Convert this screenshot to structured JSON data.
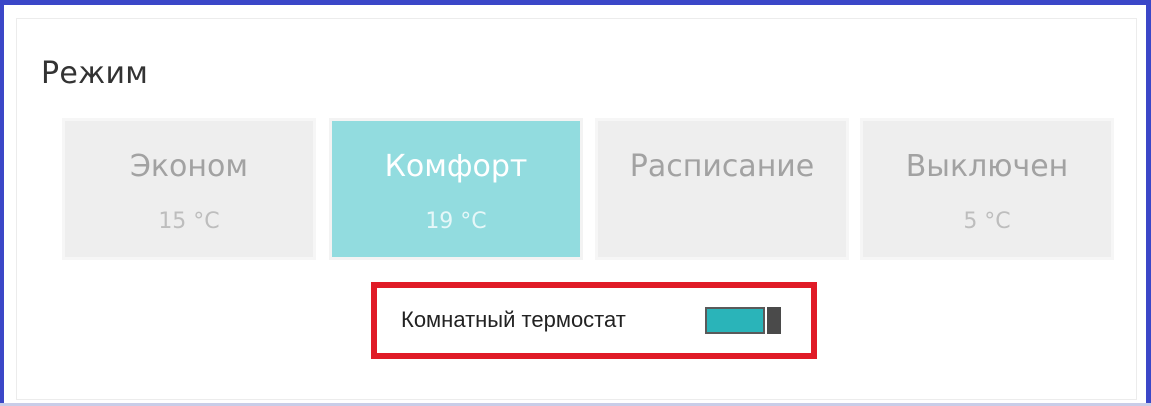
{
  "title": "Режим",
  "modes": [
    {
      "label": "Эконом",
      "temp": "15 °C",
      "active": false
    },
    {
      "label": "Комфорт",
      "temp": "19 °C",
      "active": true
    },
    {
      "label": "Расписание",
      "temp": "",
      "active": false
    },
    {
      "label": "Выключен",
      "temp": "5 °C",
      "active": false
    }
  ],
  "thermostat": {
    "label": "Комнатный термостат",
    "enabled": true
  },
  "colors": {
    "frame_border": "#3b47c8",
    "mode_active_bg": "#92dcdf",
    "mode_inactive_bg": "#eeeeee",
    "toggle_on": "#2ab4b9",
    "highlight": "#e01b27"
  }
}
